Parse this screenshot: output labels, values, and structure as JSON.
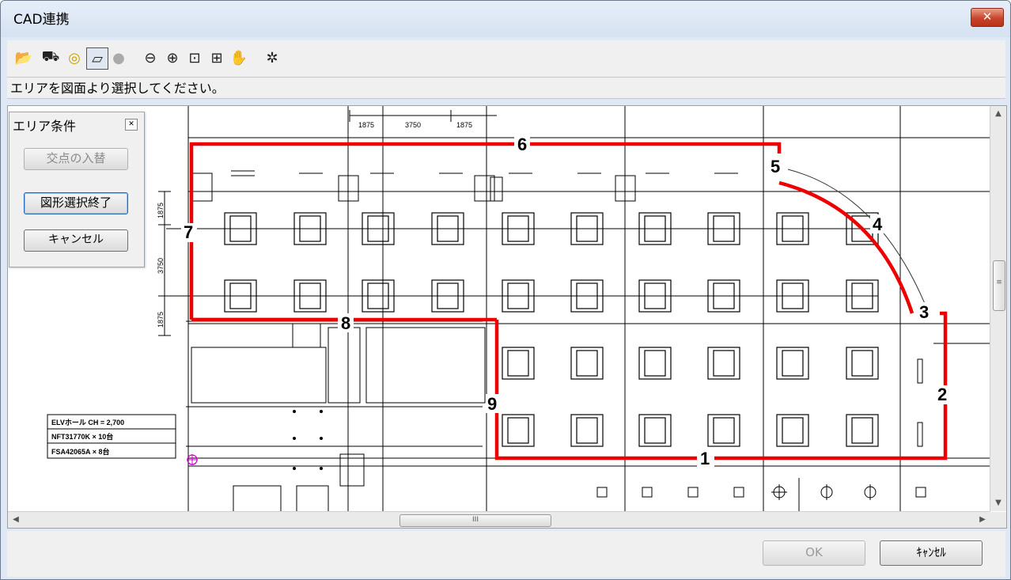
{
  "window": {
    "title": "CAD連携",
    "close_label": "✕"
  },
  "toolbar": {
    "buttons": [
      {
        "icon": "open-folder-icon",
        "glyph": "📂"
      },
      {
        "icon": "area-select-icon",
        "glyph": "⛟"
      },
      {
        "icon": "target-icon",
        "glyph": "◎"
      },
      {
        "icon": "area-frame-icon",
        "glyph": "▱"
      },
      {
        "icon": "bulb-icon",
        "glyph": "●"
      },
      {
        "icon": "zoom-out-icon",
        "glyph": "⊖"
      },
      {
        "icon": "zoom-in-icon",
        "glyph": "⊕"
      },
      {
        "icon": "zoom-window-icon",
        "glyph": "⊡"
      },
      {
        "icon": "zoom-fit-icon",
        "glyph": "⊞"
      },
      {
        "icon": "pan-hand-icon",
        "glyph": "✋"
      },
      {
        "icon": "settings-gear-icon",
        "glyph": "✲"
      }
    ]
  },
  "status": {
    "message": "エリアを図面より選択してください。"
  },
  "panel": {
    "title": "エリア条件",
    "close_label": "✕",
    "swap_label": "交点の入替",
    "finish_label": "図形選択終了",
    "cancel_label": "キャンセル"
  },
  "drawing": {
    "dimensions": {
      "top": [
        "1875",
        "3750",
        "1875"
      ],
      "left": [
        "1875",
        "3750",
        "1875"
      ]
    },
    "legend": [
      "ELVホール CH = 2,700",
      "NFT31770K × 10台",
      "FSA42065A × 8台"
    ],
    "point_labels": [
      "1",
      "2",
      "3",
      "4",
      "5",
      "6",
      "7",
      "8",
      "9"
    ],
    "boundary_color": "#ee0000"
  },
  "scrollbar": {
    "thumb_label": "III",
    "vthumb_label": "≡"
  },
  "footer": {
    "ok_label": "OK",
    "cancel_label": "ｷｬﾝｾﾙ"
  }
}
